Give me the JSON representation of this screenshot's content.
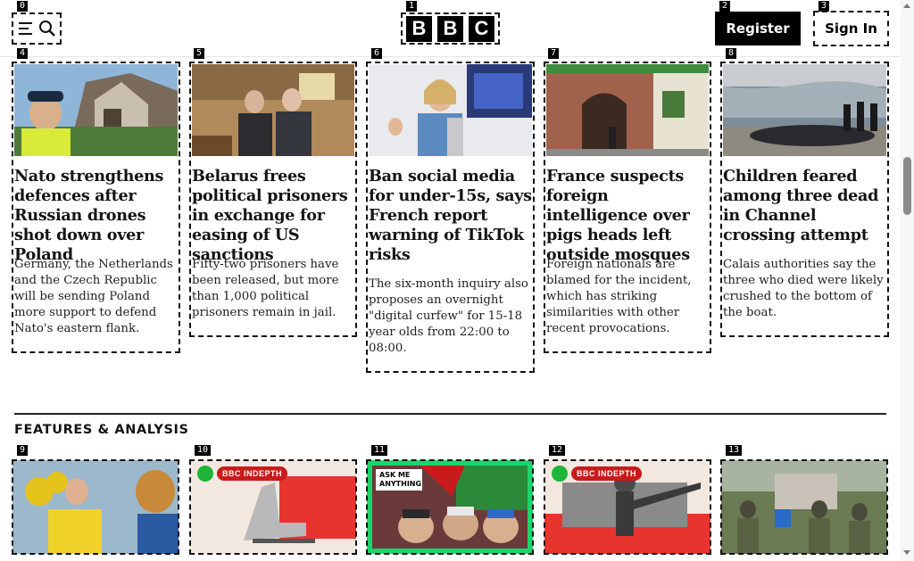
{
  "header": {
    "badges": [
      "0",
      "1",
      "2",
      "3"
    ],
    "logo_letters": [
      "B",
      "B",
      "C"
    ],
    "register_label": "Register",
    "signin_label": "Sign In"
  },
  "top_stories": [
    {
      "badge": "4",
      "headline": "Nato strengthens defences after Russian drones shot down over Poland",
      "summary": "Germany, the Netherlands and the Czech Republic will be sending Poland more support to defend Nato's eastern flank."
    },
    {
      "badge": "5",
      "headline": "Belarus frees political prisoners in exchange for easing of US sanctions",
      "summary": "Fifty-two prisoners have been released, but more than 1,000 political prisoners remain in jail."
    },
    {
      "badge": "6",
      "headline": "Ban social media for under-15s, says French report warning of TikTok risks",
      "summary": "The six-month inquiry also proposes an overnight \"digital curfew\" for 15-18 year olds from 22:00 to 08:00."
    },
    {
      "badge": "7",
      "headline": "France suspects foreign intelligence over pigs heads left outside mosques",
      "summary": "Foreign nationals are blamed for the incident, which has striking similarities with other recent provocations."
    },
    {
      "badge": "8",
      "headline": "Children feared among three dead in Channel crossing attempt",
      "summary": "Calais authorities say the three who died were likely crushed to the bottom of the boat."
    }
  ],
  "features": {
    "title": "FEATURES & ANALYSIS",
    "cards": [
      {
        "badge": "9"
      },
      {
        "badge": "10",
        "tag": "BBC INDEPTH"
      },
      {
        "badge": "11",
        "tag": "ASK ME ANYTHING"
      },
      {
        "badge": "12",
        "tag": "BBC INDEPTH"
      },
      {
        "badge": "13"
      }
    ]
  },
  "colors": {
    "indepth_red": "#c91b1b",
    "indepth_green": "#1db53a",
    "ama_green": "#19d66b"
  },
  "icons": [
    "menu-icon",
    "search-icon"
  ]
}
